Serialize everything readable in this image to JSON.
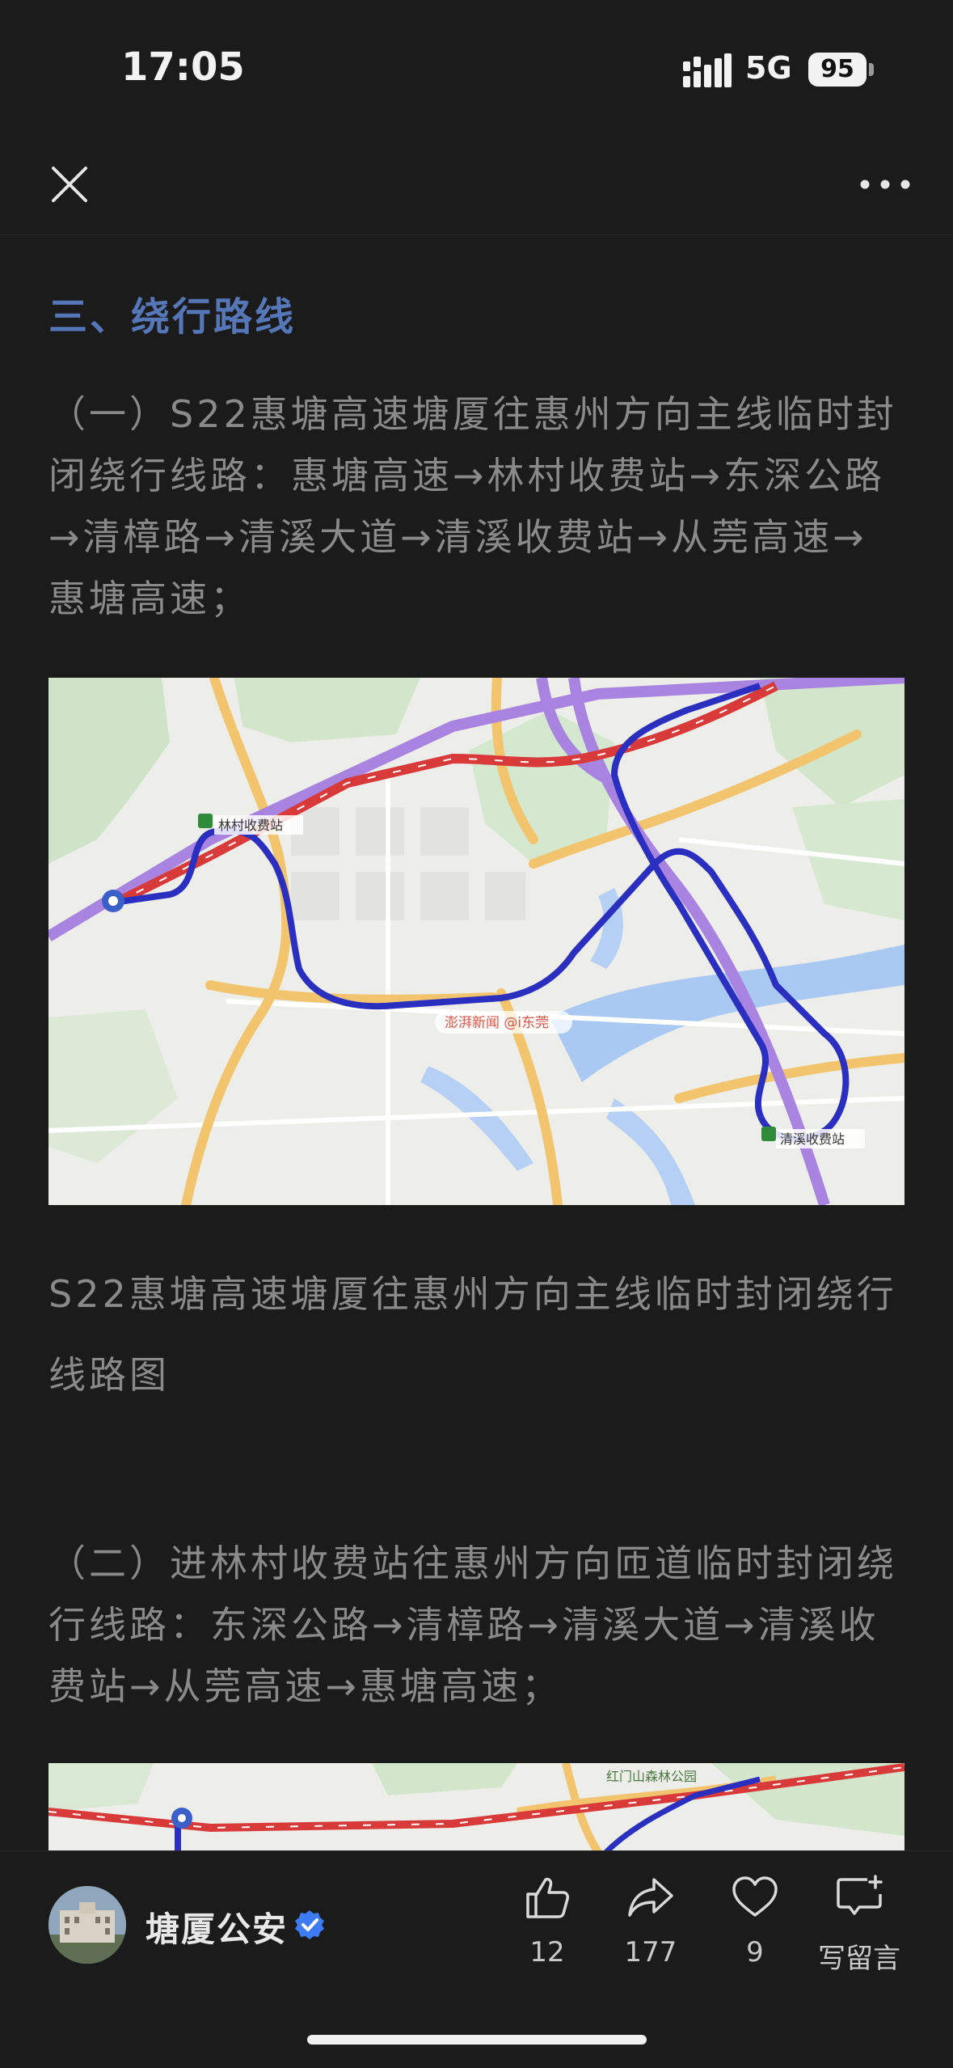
{
  "status": {
    "time": "17:05",
    "network": "5G",
    "battery": "95"
  },
  "article": {
    "section_title": "三、绕行路线",
    "para1": "（一）S22惠塘高速塘厦往惠州方向主线临时封闭绕行线路：惠塘高速→林村收费站→东深公路→清樟路→清溪大道→清溪收费站→从莞高速→惠塘高速；",
    "caption1": "S22惠塘高速塘厦往惠州方向主线临时封闭绕行线路图",
    "para2": "（二）进林村收费站往惠州方向匝道临时封闭绕行线路：东深公路→清樟路→清溪大道→清溪收费站→从莞高速→惠塘高速；"
  },
  "map1": {
    "labels": {
      "lincun_toll": "林村收费站",
      "qingxi_toll": "清溪收费站",
      "watermark": "澎湃新闻 @i东莞"
    }
  },
  "map2": {
    "labels": {
      "park": "红门山森林公园"
    }
  },
  "footer": {
    "author": "塘厦公安",
    "like_count": "12",
    "share_count": "177",
    "fav_count": "9",
    "comment_label": "写留言"
  },
  "icons": [
    "close-icon",
    "more-icon",
    "verified-icon",
    "like-icon",
    "share-icon",
    "heart-icon",
    "comment-icon"
  ],
  "colors": {
    "accent": "#5577b8",
    "route": "#2a2fc0",
    "highway": "#d83a3a",
    "verified": "#3d7bf5"
  }
}
